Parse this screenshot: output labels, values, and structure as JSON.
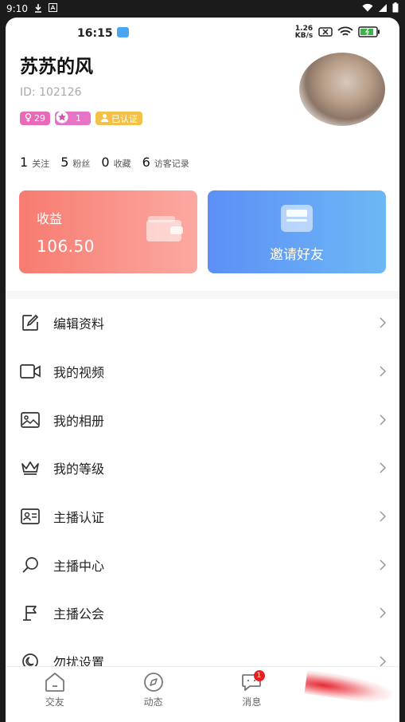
{
  "system_status": {
    "time": "9:10",
    "download_icon": "download-icon",
    "notification_icon": "app-notification-icon"
  },
  "inner_status": {
    "time": "16:15",
    "net_speed": "1.26 KB/s",
    "battery_color": "#3bb34a"
  },
  "profile": {
    "name": "苏苏的风",
    "id_text": "ID: 102126",
    "badges": {
      "gender_age": "29",
      "level": "1",
      "verified": "已认证"
    }
  },
  "stats": [
    {
      "num": "1",
      "label": "关注"
    },
    {
      "num": "5",
      "label": "粉丝"
    },
    {
      "num": "0",
      "label": "收藏"
    },
    {
      "num": "6",
      "label": "访客记录"
    }
  ],
  "cards": {
    "income": {
      "title": "收益",
      "amount": "106.50",
      "color_start": "#f77b70",
      "color_end": "#fba9a2"
    },
    "invite": {
      "label": "邀请好友",
      "color_start": "#5c8ff6",
      "color_end": "#6db8f5"
    }
  },
  "menu": [
    {
      "label": "编辑资料",
      "icon": "edit-icon"
    },
    {
      "label": "我的视频",
      "icon": "video-icon"
    },
    {
      "label": "我的相册",
      "icon": "photo-album-icon"
    },
    {
      "label": "我的等级",
      "icon": "crown-icon"
    },
    {
      "label": "主播认证",
      "icon": "id-card-icon"
    },
    {
      "label": "主播中心",
      "icon": "search-icon"
    },
    {
      "label": "主播公会",
      "icon": "flag-icon"
    },
    {
      "label": "勿扰设置",
      "icon": "moon-icon"
    }
  ],
  "tabbar": {
    "tabs": [
      {
        "label": "交友",
        "icon": "home-icon"
      },
      {
        "label": "动态",
        "icon": "compass-icon"
      },
      {
        "label": "消息",
        "icon": "message-icon",
        "badge": "1"
      },
      {
        "label": "",
        "icon": "profile-icon"
      }
    ]
  }
}
